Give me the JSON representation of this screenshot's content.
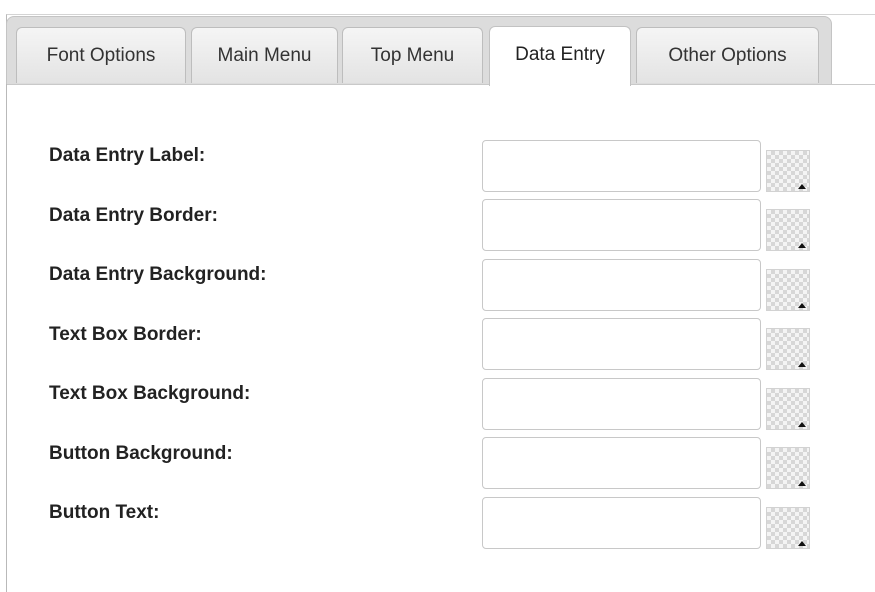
{
  "tabs": [
    {
      "label": "Font Options"
    },
    {
      "label": "Main Menu"
    },
    {
      "label": "Top Menu"
    },
    {
      "label": "Data Entry"
    },
    {
      "label": "Other Options"
    }
  ],
  "active_tab": "Data Entry",
  "fields": [
    {
      "label": "Data Entry Label:",
      "value": ""
    },
    {
      "label": "Data Entry Border:",
      "value": ""
    },
    {
      "label": "Data Entry Background:",
      "value": ""
    },
    {
      "label": "Text Box Border:",
      "value": ""
    },
    {
      "label": "Text Box Background:",
      "value": ""
    },
    {
      "label": "Button Background:",
      "value": ""
    },
    {
      "label": "Button Text:",
      "value": ""
    }
  ],
  "picker": {
    "icon": "color-picker-icon",
    "arrow_icon": "caret-up-icon"
  }
}
